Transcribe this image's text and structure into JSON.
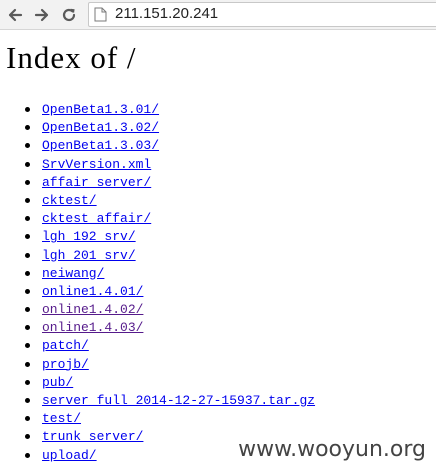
{
  "browser": {
    "url": "211.151.20.241",
    "icons": {
      "back": "back-arrow-icon",
      "forward": "forward-arrow-icon",
      "reload": "reload-icon",
      "page": "page-icon"
    }
  },
  "page": {
    "title": "Index of /",
    "entries": [
      {
        "name": "OpenBeta1.3.01/",
        "visited": false
      },
      {
        "name": "OpenBeta1.3.02/",
        "visited": false
      },
      {
        "name": "OpenBeta1.3.03/",
        "visited": false
      },
      {
        "name": "SrvVersion.xml",
        "visited": false
      },
      {
        "name": "affair_server/",
        "visited": false
      },
      {
        "name": "cktest/",
        "visited": false
      },
      {
        "name": "cktest_affair/",
        "visited": false
      },
      {
        "name": "lgh_192_srv/",
        "visited": false
      },
      {
        "name": "lgh_201_srv/",
        "visited": false
      },
      {
        "name": "neiwang/",
        "visited": false
      },
      {
        "name": "online1.4.01/",
        "visited": false
      },
      {
        "name": "online1.4.02/",
        "visited": true
      },
      {
        "name": "online1.4.03/",
        "visited": true
      },
      {
        "name": "patch/",
        "visited": false
      },
      {
        "name": "projb/",
        "visited": false
      },
      {
        "name": "pub/",
        "visited": false
      },
      {
        "name": "server_full_2014-12-27-15937.tar.gz",
        "visited": false
      },
      {
        "name": "test/",
        "visited": false
      },
      {
        "name": "trunk_server/",
        "visited": false
      },
      {
        "name": "upload/",
        "visited": false
      }
    ]
  },
  "watermark": "www.wooyun.org"
}
